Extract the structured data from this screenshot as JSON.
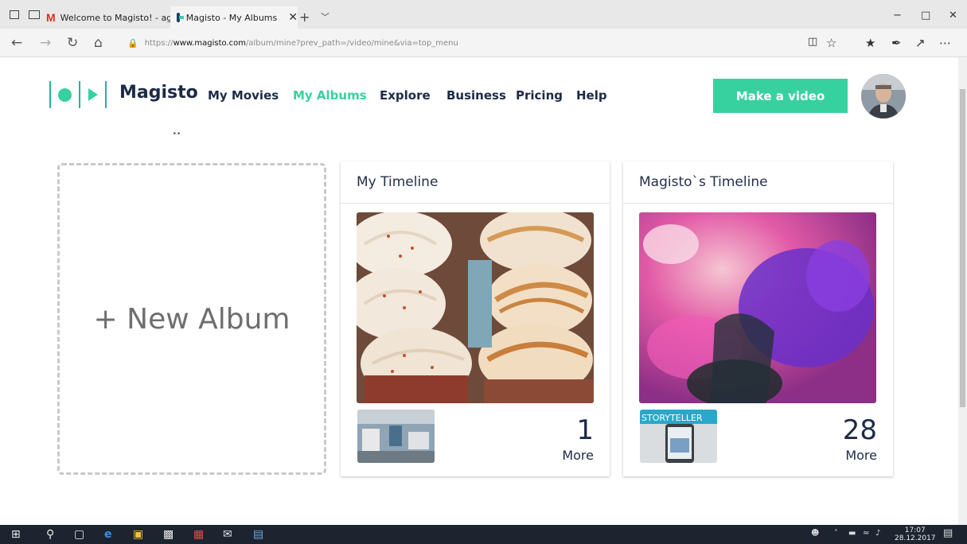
{
  "browser": {
    "tabs": [
      {
        "title": "Welcome to Magisto! - agai",
        "icon": "gmail-icon"
      },
      {
        "title": "Magisto - My Albums",
        "icon": "magisto-favicon"
      }
    ],
    "tab_close": "✕",
    "new_tab": "+",
    "tab_list": "﹀",
    "url_scheme": "https://",
    "url_host": "www.magisto.com",
    "url_path": "/album/mine?prev_path=/video/mine&via=top_menu",
    "window_controls": {
      "minimize": "−",
      "maximize": "□",
      "close": "✕"
    }
  },
  "site": {
    "brand": "Magisto",
    "nav": [
      {
        "label": "My Movies",
        "active": false
      },
      {
        "label": "My Albums",
        "active": true
      },
      {
        "label": "Explore",
        "active": false
      },
      {
        "label": "Business",
        "active": false
      },
      {
        "label": "Pricing",
        "active": false
      },
      {
        "label": "Help",
        "active": false
      }
    ],
    "cta": "Make a video",
    "accent_color": "#37d1a0",
    "brand_color": "#1c2b46"
  },
  "albums": {
    "new_album_label": "+ New Album",
    "cards": [
      {
        "title": "My Timeline",
        "count": "1",
        "more": "More",
        "thumb_label": ""
      },
      {
        "title": "Magisto`s Timeline",
        "count": "28",
        "more": "More",
        "thumb_label": "STORYTELLER"
      }
    ]
  },
  "taskbar": {
    "time": "17:07",
    "date": "28.12.2017"
  }
}
